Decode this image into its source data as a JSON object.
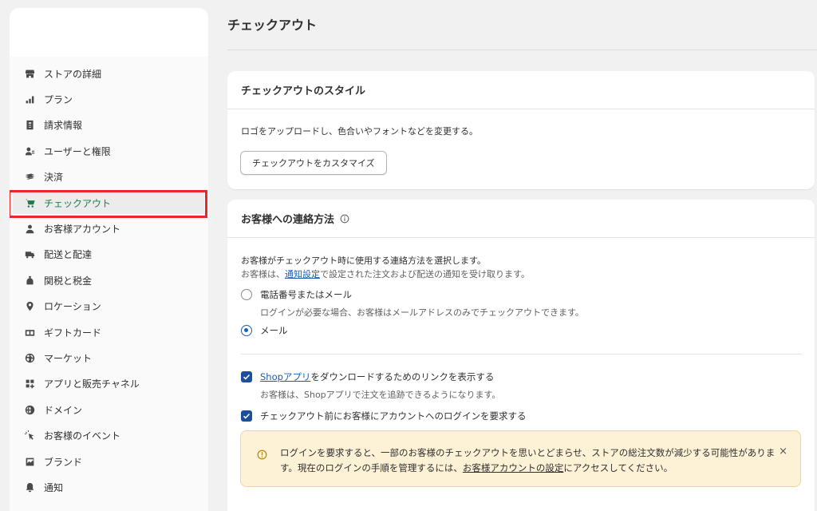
{
  "sidebar": {
    "items": [
      {
        "label": "ストアの詳細",
        "icon": "store-icon"
      },
      {
        "label": "プラン",
        "icon": "plan-chart-icon"
      },
      {
        "label": "請求情報",
        "icon": "billing-icon"
      },
      {
        "label": "ユーザーと権限",
        "icon": "users-icon"
      },
      {
        "label": "決済",
        "icon": "payments-icon"
      },
      {
        "label": "チェックアウト",
        "icon": "cart-icon",
        "active": true
      },
      {
        "label": "お客様アカウント",
        "icon": "person-icon"
      },
      {
        "label": "配送と配達",
        "icon": "truck-icon"
      },
      {
        "label": "関税と税金",
        "icon": "tax-bag-icon"
      },
      {
        "label": "ロケーション",
        "icon": "location-pin-icon"
      },
      {
        "label": "ギフトカード",
        "icon": "gift-card-icon"
      },
      {
        "label": "マーケット",
        "icon": "globe-icon"
      },
      {
        "label": "アプリと販売チャネル",
        "icon": "apps-grid-icon"
      },
      {
        "label": "ドメイン",
        "icon": "domain-globe-icon"
      },
      {
        "label": "お客様のイベント",
        "icon": "cursor-click-icon"
      },
      {
        "label": "ブランド",
        "icon": "brand-image-icon"
      },
      {
        "label": "通知",
        "icon": "bell-icon"
      }
    ],
    "active_color": "#1f7a4d",
    "highlight_color": "#e8272b"
  },
  "main": {
    "title": "チェックアウト",
    "style_card": {
      "heading": "チェックアウトのスタイル",
      "description": "ロゴをアップロードし、色合いやフォントなどを変更する。",
      "button_label": "チェックアウトをカスタマイズ"
    },
    "contact_card": {
      "heading": "お客様への連絡方法",
      "line1": "お客様がチェックアウト時に使用する連絡方法を選択します。",
      "line2_prefix": "お客様は、",
      "line2_link": "通知設定",
      "line2_suffix": "で設定された注文および配送の通知を受け取ります。",
      "radio_phone_label": "電話番号またはメール",
      "radio_phone_helper": "ログインが必要な場合、お客様はメールアドレスのみでチェックアウトできます。",
      "radio_email_label": "メール",
      "selected": "メール",
      "shop_check_link": "Shopアプリ",
      "shop_check_suffix": "をダウンロードするためのリンクを表示する",
      "shop_check_helper": "お客様は、Shopアプリで注文を追跡できるようになります。",
      "login_check_label": "チェックアウト前にお客様にアカウントへのログインを要求する",
      "banner_text_1": "ログインを要求すると、一部のお客様のチェックアウトを思いとどまらせ、ストアの総注文数が減少する可能性があります。現在のログインの手順を管理するには、",
      "banner_link": "お客様アカウントの設定",
      "banner_text_2": "にアクセスしてください。",
      "banner_close": "×"
    },
    "accent_color": "#1a5fb4"
  }
}
